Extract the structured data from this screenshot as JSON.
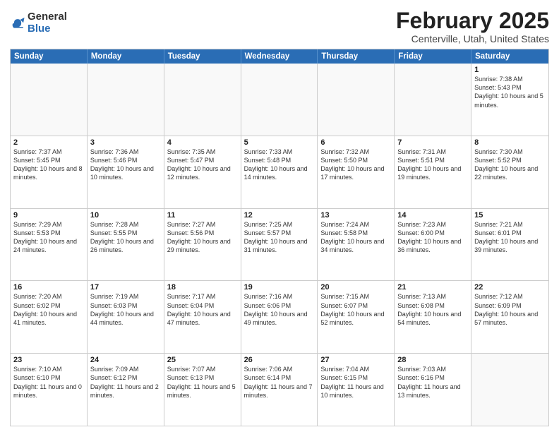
{
  "logo": {
    "general": "General",
    "blue": "Blue"
  },
  "header": {
    "title": "February 2025",
    "subtitle": "Centerville, Utah, United States"
  },
  "weekdays": [
    "Sunday",
    "Monday",
    "Tuesday",
    "Wednesday",
    "Thursday",
    "Friday",
    "Saturday"
  ],
  "rows": [
    [
      {
        "day": "",
        "info": ""
      },
      {
        "day": "",
        "info": ""
      },
      {
        "day": "",
        "info": ""
      },
      {
        "day": "",
        "info": ""
      },
      {
        "day": "",
        "info": ""
      },
      {
        "day": "",
        "info": ""
      },
      {
        "day": "1",
        "info": "Sunrise: 7:38 AM\nSunset: 5:43 PM\nDaylight: 10 hours and 5 minutes."
      }
    ],
    [
      {
        "day": "2",
        "info": "Sunrise: 7:37 AM\nSunset: 5:45 PM\nDaylight: 10 hours and 8 minutes."
      },
      {
        "day": "3",
        "info": "Sunrise: 7:36 AM\nSunset: 5:46 PM\nDaylight: 10 hours and 10 minutes."
      },
      {
        "day": "4",
        "info": "Sunrise: 7:35 AM\nSunset: 5:47 PM\nDaylight: 10 hours and 12 minutes."
      },
      {
        "day": "5",
        "info": "Sunrise: 7:33 AM\nSunset: 5:48 PM\nDaylight: 10 hours and 14 minutes."
      },
      {
        "day": "6",
        "info": "Sunrise: 7:32 AM\nSunset: 5:50 PM\nDaylight: 10 hours and 17 minutes."
      },
      {
        "day": "7",
        "info": "Sunrise: 7:31 AM\nSunset: 5:51 PM\nDaylight: 10 hours and 19 minutes."
      },
      {
        "day": "8",
        "info": "Sunrise: 7:30 AM\nSunset: 5:52 PM\nDaylight: 10 hours and 22 minutes."
      }
    ],
    [
      {
        "day": "9",
        "info": "Sunrise: 7:29 AM\nSunset: 5:53 PM\nDaylight: 10 hours and 24 minutes."
      },
      {
        "day": "10",
        "info": "Sunrise: 7:28 AM\nSunset: 5:55 PM\nDaylight: 10 hours and 26 minutes."
      },
      {
        "day": "11",
        "info": "Sunrise: 7:27 AM\nSunset: 5:56 PM\nDaylight: 10 hours and 29 minutes."
      },
      {
        "day": "12",
        "info": "Sunrise: 7:25 AM\nSunset: 5:57 PM\nDaylight: 10 hours and 31 minutes."
      },
      {
        "day": "13",
        "info": "Sunrise: 7:24 AM\nSunset: 5:58 PM\nDaylight: 10 hours and 34 minutes."
      },
      {
        "day": "14",
        "info": "Sunrise: 7:23 AM\nSunset: 6:00 PM\nDaylight: 10 hours and 36 minutes."
      },
      {
        "day": "15",
        "info": "Sunrise: 7:21 AM\nSunset: 6:01 PM\nDaylight: 10 hours and 39 minutes."
      }
    ],
    [
      {
        "day": "16",
        "info": "Sunrise: 7:20 AM\nSunset: 6:02 PM\nDaylight: 10 hours and 41 minutes."
      },
      {
        "day": "17",
        "info": "Sunrise: 7:19 AM\nSunset: 6:03 PM\nDaylight: 10 hours and 44 minutes."
      },
      {
        "day": "18",
        "info": "Sunrise: 7:17 AM\nSunset: 6:04 PM\nDaylight: 10 hours and 47 minutes."
      },
      {
        "day": "19",
        "info": "Sunrise: 7:16 AM\nSunset: 6:06 PM\nDaylight: 10 hours and 49 minutes."
      },
      {
        "day": "20",
        "info": "Sunrise: 7:15 AM\nSunset: 6:07 PM\nDaylight: 10 hours and 52 minutes."
      },
      {
        "day": "21",
        "info": "Sunrise: 7:13 AM\nSunset: 6:08 PM\nDaylight: 10 hours and 54 minutes."
      },
      {
        "day": "22",
        "info": "Sunrise: 7:12 AM\nSunset: 6:09 PM\nDaylight: 10 hours and 57 minutes."
      }
    ],
    [
      {
        "day": "23",
        "info": "Sunrise: 7:10 AM\nSunset: 6:10 PM\nDaylight: 11 hours and 0 minutes."
      },
      {
        "day": "24",
        "info": "Sunrise: 7:09 AM\nSunset: 6:12 PM\nDaylight: 11 hours and 2 minutes."
      },
      {
        "day": "25",
        "info": "Sunrise: 7:07 AM\nSunset: 6:13 PM\nDaylight: 11 hours and 5 minutes."
      },
      {
        "day": "26",
        "info": "Sunrise: 7:06 AM\nSunset: 6:14 PM\nDaylight: 11 hours and 7 minutes."
      },
      {
        "day": "27",
        "info": "Sunrise: 7:04 AM\nSunset: 6:15 PM\nDaylight: 11 hours and 10 minutes."
      },
      {
        "day": "28",
        "info": "Sunrise: 7:03 AM\nSunset: 6:16 PM\nDaylight: 11 hours and 13 minutes."
      },
      {
        "day": "",
        "info": ""
      }
    ]
  ]
}
